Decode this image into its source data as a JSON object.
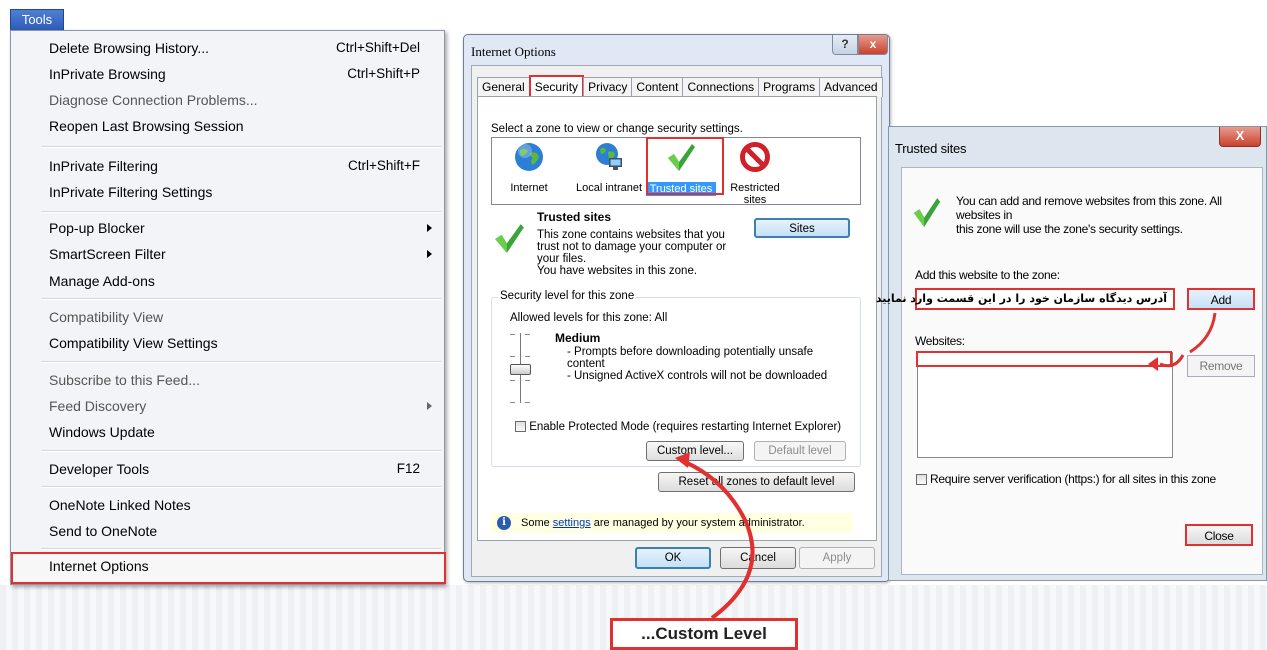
{
  "tools_menu": {
    "button_label": "Tools",
    "items": [
      {
        "label": "Delete Browsing History...",
        "shortcut": "Ctrl+Shift+Del"
      },
      {
        "label": "InPrivate Browsing",
        "shortcut": "Ctrl+Shift+P"
      },
      {
        "label": "Diagnose Connection Problems...",
        "disabled": true
      },
      {
        "label": "Reopen Last Browsing Session"
      },
      {
        "label": "InPrivate Filtering",
        "shortcut": "Ctrl+Shift+F"
      },
      {
        "label": "InPrivate Filtering Settings"
      },
      {
        "label": "Pop-up Blocker",
        "submenu": true
      },
      {
        "label": "SmartScreen Filter",
        "submenu": true
      },
      {
        "label": "Manage Add-ons"
      },
      {
        "label": "Compatibility View",
        "disabled": true
      },
      {
        "label": "Compatibility View Settings"
      },
      {
        "label": "Subscribe to this Feed...",
        "disabled": true
      },
      {
        "label": "Feed Discovery",
        "disabled": true,
        "submenu": true
      },
      {
        "label": "Windows Update"
      },
      {
        "label": "Developer Tools",
        "shortcut": "F12"
      },
      {
        "label": "OneNote Linked Notes"
      },
      {
        "label": "Send to OneNote"
      },
      {
        "label": "Internet Options",
        "highlighted": true
      }
    ]
  },
  "internet_options": {
    "title": "Internet Options",
    "help_label": "?",
    "close_label": "x",
    "tabs": [
      "General",
      "Security",
      "Privacy",
      "Content",
      "Connections",
      "Programs",
      "Advanced"
    ],
    "active_tab": "Security",
    "zone_prompt": "Select a zone to view or change security settings.",
    "zones": [
      {
        "label": "Internet",
        "icon": "globe-icon"
      },
      {
        "label": "Local intranet",
        "icon": "intranet-globe-icon"
      },
      {
        "label": "Trusted sites",
        "icon": "checkmark-icon",
        "selected": true
      },
      {
        "label": "Restricted sites",
        "icon": "restricted-icon"
      }
    ],
    "zone_title": "Trusted sites",
    "zone_desc_1": "This zone contains websites that you",
    "zone_desc_2": "trust not to damage your computer or",
    "zone_desc_3": "your files.",
    "zone_desc_4": "You have websites in this zone.",
    "sites_button": "Sites",
    "security_level_legend": "Security level for this zone",
    "allowed_levels": "Allowed levels for this zone: All",
    "level_name": "Medium",
    "level_desc_1": "- Prompts before downloading potentially unsafe",
    "level_desc_2": "content",
    "level_desc_3": "- Unsigned ActiveX controls will not be downloaded",
    "protected_mode": "Enable Protected Mode (requires restarting Internet Explorer)",
    "custom_level_button": "Custom level...",
    "default_level_button": "Default level",
    "reset_button": "Reset all zones to default level",
    "info_prefix": "Some ",
    "info_link": "settings",
    "info_suffix": " are managed by your system administrator.",
    "ok_button": "OK",
    "cancel_button": "Cancel",
    "apply_button": "Apply"
  },
  "trusted_sites": {
    "title": "Trusted sites",
    "close_label": "X",
    "info_line_1": "You can add and remove websites from this zone. All websites in",
    "info_line_2": "this zone will use the zone's security settings.",
    "add_label": "Add this website to the zone:",
    "add_value": "آدرس دیدگاه سازمان خود را در این قسمت وارد نمایید",
    "add_button": "Add",
    "websites_label": "Websites:",
    "remove_button": "Remove",
    "require_https": "Require server verification (https:) for all sites in this zone",
    "close_button": "Close"
  },
  "caption": "...Custom Level",
  "colors": {
    "highlight_red": "#e03030",
    "selected_blue": "#3399ff",
    "check_green": "#3aa33a"
  }
}
